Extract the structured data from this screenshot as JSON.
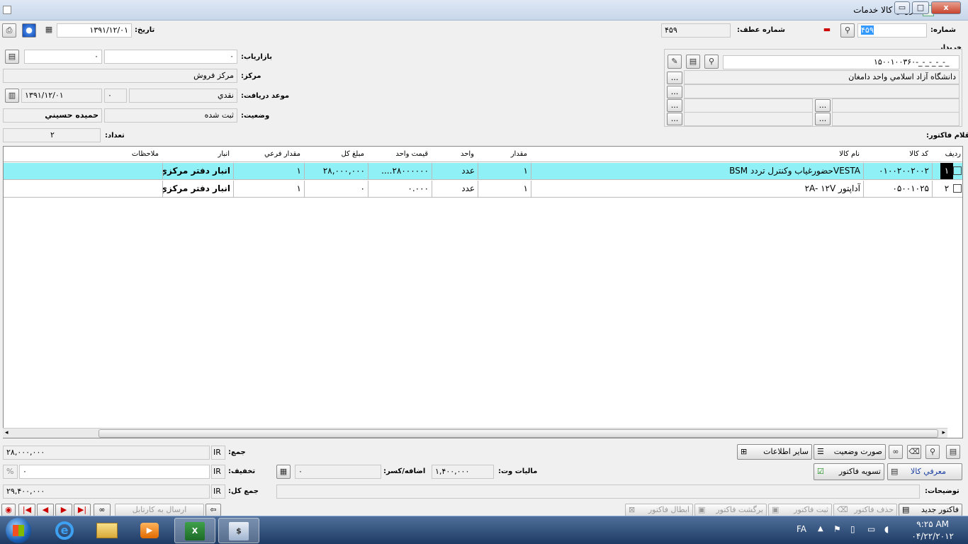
{
  "window": {
    "title": "فروش كالا خدمات",
    "controls": {
      "minimize": "▭",
      "maximize": "□",
      "close": "x"
    }
  },
  "header": {
    "number_label": "شماره:",
    "number_value": "۴۵۹",
    "ref_number_label": "شماره عطف:",
    "ref_number_value": "۴۵۹",
    "date_label": "تاريخ:",
    "date_value": "۱۳۹۱/۱۲/۰۱"
  },
  "buyer": {
    "section_label": "خريدار",
    "code_value": "۱۵۰۰۱۰۰۳۶۰-_-_-_-_-_",
    "name_value": "دانشگاه  آزاد اسلامي واحد دامغان",
    "ellipsis": "..."
  },
  "left_panel": {
    "marketer_label": "بازارياب:",
    "marketer_value": "۰",
    "marketer_value2": "۰",
    "center_label": "مركز:",
    "center_value": "مركز فروش",
    "due_label": "موعد دريافت:",
    "due_type": "نقدي",
    "due_days": "۰",
    "due_date": "۱۳۹۱/۱۲/۰۱",
    "status_label": "وضعيت:",
    "status_value": "ثبت شده",
    "user_value": "حميده حسيني",
    "count_label": "تعداد:",
    "count_value": "۲"
  },
  "items_label": "اقلام فاكتور:",
  "table": {
    "columns": [
      "رديف",
      "كد كالا",
      "نام كالا",
      "مقدار",
      "واحد",
      "قيمت واحد",
      "مبلغ كل",
      "مقدار فرعي",
      "انبار",
      "ملاحظات"
    ],
    "rows": [
      {
        "row": "۱",
        "code": "۰۱۰۰۲۰۰۲۰۰۲",
        "name": "VESTAحضورغياب وكنترل تردد BSM",
        "qty": "۱",
        "unit": "عدد",
        "unit_price": "۲۸۰۰۰۰۰۰....",
        "total": "۲۸,۰۰۰,۰۰۰",
        "sub_qty": "۱",
        "warehouse": "انبار دفتر مركزي",
        "notes": ""
      },
      {
        "row": "۲",
        "code": "۰۵۰۰۱۰۲۵",
        "name": "آداپتور ۲A- ۱۲V",
        "qty": "۱",
        "unit": "عدد",
        "unit_price": "۰.۰۰۰",
        "total": "۰",
        "sub_qty": "۱",
        "warehouse": "انبار دفتر مركزي",
        "notes": ""
      }
    ]
  },
  "totals": {
    "sum_label": "جمع:",
    "sum_value": "۲۸,۰۰۰,۰۰۰",
    "currency": "IR",
    "discount_label": "تخفيف:",
    "discount_value": "۰",
    "percent": "%",
    "grand_label": "جمع كل:",
    "grand_value": "۲۹,۴۰۰,۰۰۰",
    "vat_label": "ماليات وت:",
    "vat_value": "۱,۴۰۰,۰۰۰",
    "add_label": "اضافه/كسر:",
    "add_value": "۰",
    "notes_label": "توضيحات:"
  },
  "action_buttons": {
    "status_report": "صورت وضعيت",
    "other_info": "ساير اطلاعات",
    "introduce_goods": "معرفي كالا",
    "settle_invoice": "تسويه فاكتور",
    "new_invoice": "فاكتور جديد",
    "delete_invoice": "حذف فاكتور",
    "register_invoice": "ثبت فاكتور",
    "return_invoice": "برگشت فاكتور",
    "cancel_invoice": "ابطال فاكتور",
    "send_to_cardex": "ارسال به كارتابل"
  },
  "taskbar": {
    "language": "FA",
    "time": "۹:۲۵ AM",
    "date": "۰۴/۲۲/۲۰۱۲"
  },
  "colors": {
    "selected_row": "#8ff0f5",
    "title_gradient_top": "#dfe9f5",
    "taskbar": "#2b4a75"
  }
}
